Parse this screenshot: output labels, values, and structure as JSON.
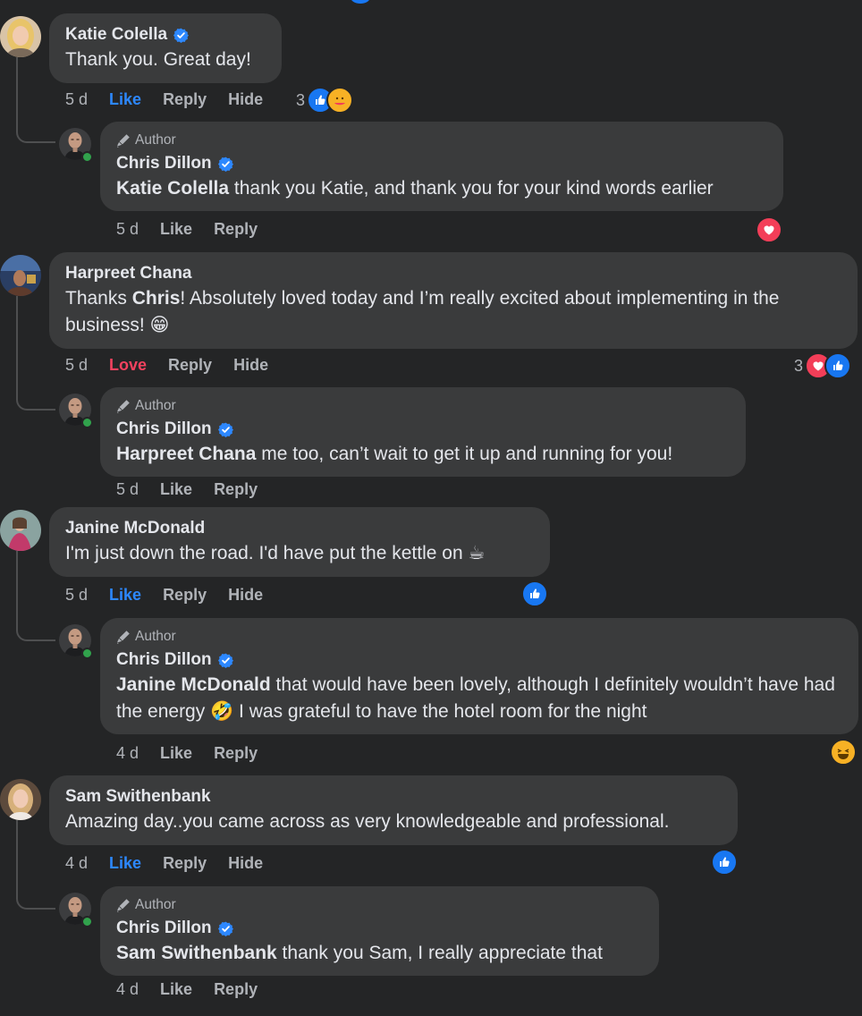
{
  "comments": [
    {
      "name": "Katie Colella",
      "text": "Thank you. Great day!",
      "time": "5 d",
      "actions": [
        "Like",
        "Reply",
        "Hide"
      ],
      "reaction_count": "3",
      "reactions": [
        "like",
        "care"
      ],
      "reply": {
        "badge": "Author",
        "name": "Chris Dillon",
        "mention": "Katie Colella",
        "text": " thank you Katie, and thank you for your kind words earlier",
        "time": "5 d",
        "actions": [
          "Like",
          "Reply"
        ],
        "reactions": [
          "love"
        ]
      }
    },
    {
      "name": "Harpreet Chana",
      "text_before": "Thanks ",
      "text_bold": "Chris",
      "text_after": "! Absolutely loved today and I’m really excited about implementing in the business! 😁",
      "time": "5 d",
      "actions": [
        "Love",
        "Reply",
        "Hide"
      ],
      "reaction_count": "3",
      "reactions": [
        "love",
        "like"
      ],
      "reply": {
        "badge": "Author",
        "name": "Chris Dillon",
        "mention": "Harpreet Chana",
        "text": " me too, can’t wait to get it up and running for you!",
        "time": "5 d",
        "actions": [
          "Like",
          "Reply"
        ]
      }
    },
    {
      "name": "Janine McDonald",
      "text": "I'm just down the road. I'd have put the kettle on ☕",
      "time": "5 d",
      "actions": [
        "Like",
        "Reply",
        "Hide"
      ],
      "reactions": [
        "like"
      ],
      "reply": {
        "badge": "Author",
        "name": "Chris Dillon",
        "mention": "Janine McDonald",
        "text": " that would have been lovely, although I definitely wouldn’t have had the energy 🤣 I was grateful to have the hotel room for the night",
        "time": "4 d",
        "actions": [
          "Like",
          "Reply"
        ],
        "reactions": [
          "haha"
        ]
      }
    },
    {
      "name": "Sam Swithenbank",
      "text": "Amazing day..you came across as very knowledgeable and professional.",
      "time": "4 d",
      "actions": [
        "Like",
        "Reply",
        "Hide"
      ],
      "reactions": [
        "like"
      ],
      "reply": {
        "badge": "Author",
        "name": "Chris Dillon",
        "mention": "Sam Swithenbank",
        "text": " thank you Sam, I really appreciate that",
        "time": "4 d",
        "actions": [
          "Like",
          "Reply"
        ]
      }
    }
  ],
  "colors": {
    "background": "#242526",
    "bubble": "#3a3b3c",
    "text": "#e4e6eb",
    "muted": "#b0b3b8",
    "like_blue": "#2d88ff",
    "love_red": "#f3425f",
    "online_green": "#31a24c"
  }
}
